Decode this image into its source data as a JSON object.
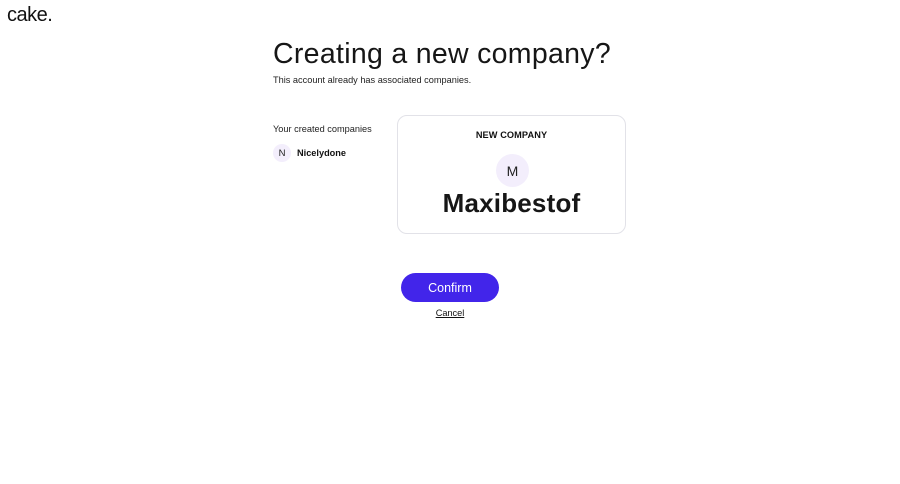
{
  "header": {
    "logo_text": "cake."
  },
  "main": {
    "title": "Creating a new company?",
    "subtitle": "This account already has associated companies."
  },
  "existing_companies": {
    "label": "Your created companies",
    "items": [
      {
        "initial": "N",
        "name": "Nicelydone"
      }
    ]
  },
  "new_company_card": {
    "heading": "NEW COMPANY",
    "initial": "M",
    "name": "Maxibestof"
  },
  "actions": {
    "confirm_label": "Confirm",
    "cancel_label": "Cancel"
  },
  "colors": {
    "accent": "#4225ea",
    "avatar_bg": "#f3eefc",
    "card_border": "#e2e2e8"
  },
  "icons": {
    "logo": "cake-logo"
  }
}
